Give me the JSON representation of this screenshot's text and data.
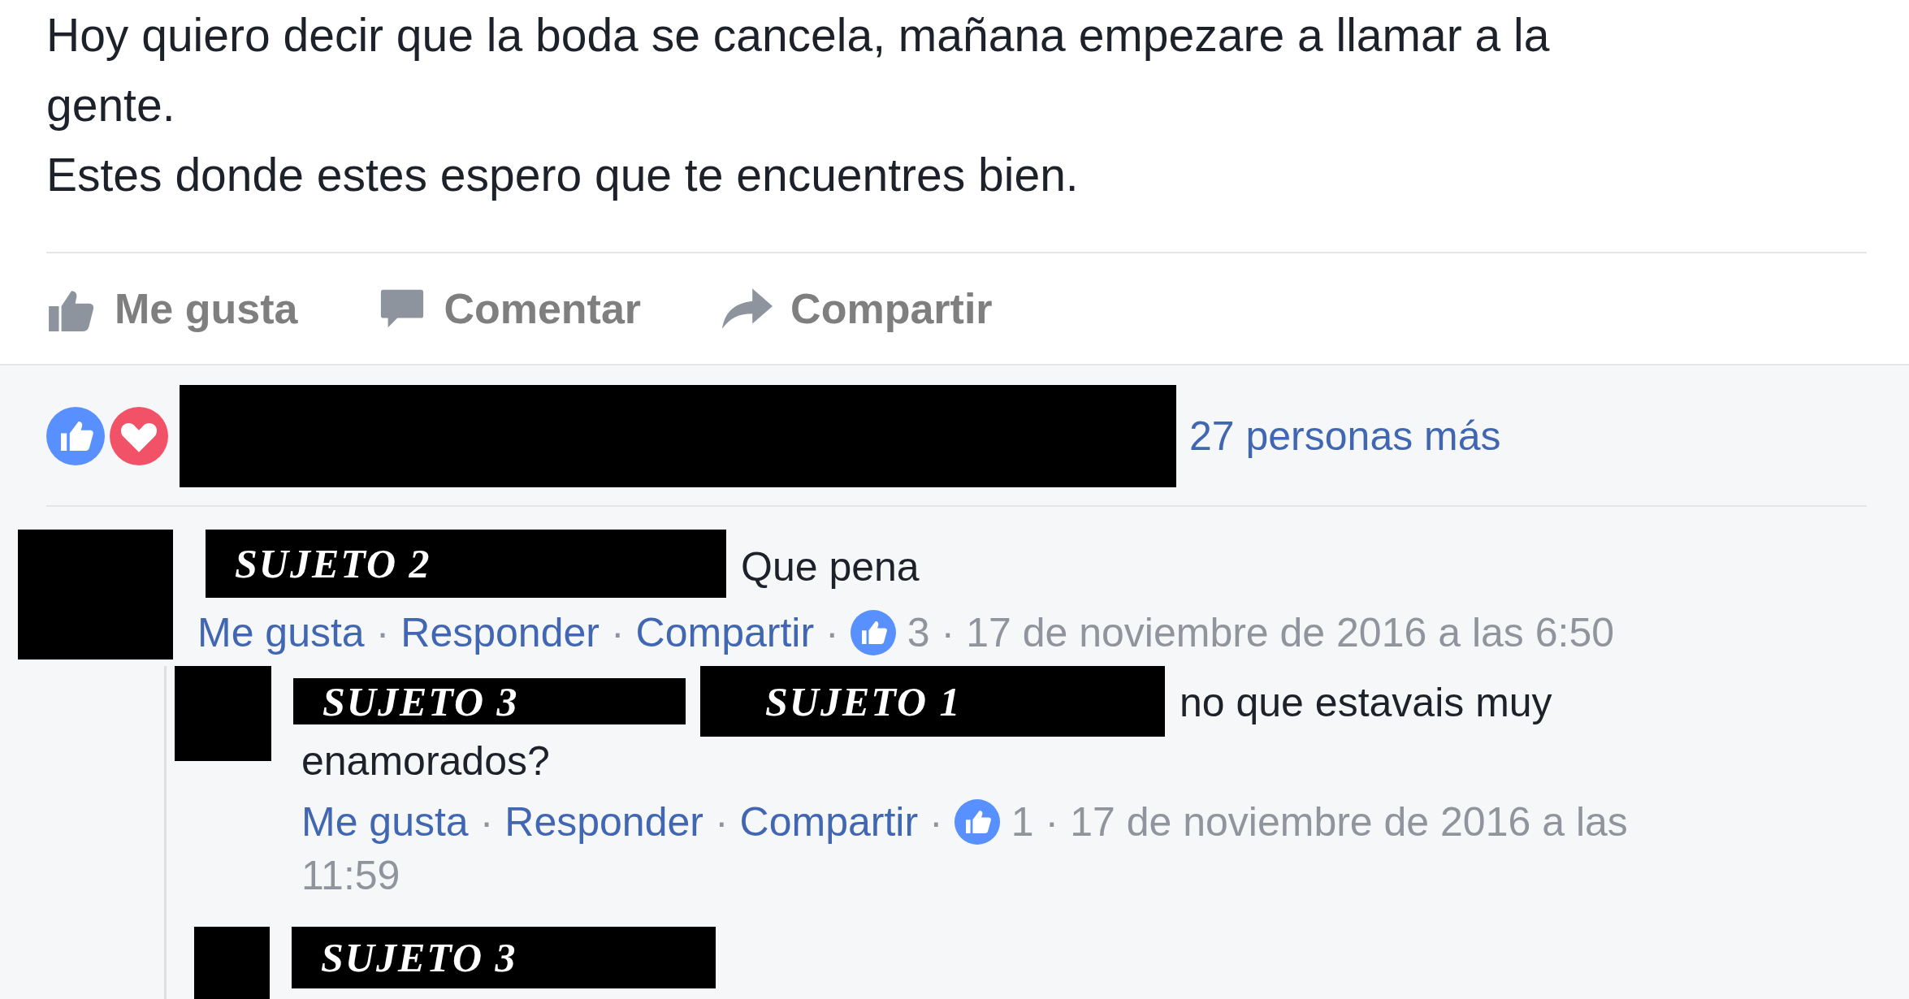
{
  "post": {
    "text_lines": [
      "Hoy quiero decir que la boda se cancela, mañana empezare a llamar a la",
      "gente.",
      "Estes donde estes espero que te encuentres bien."
    ],
    "actions": [
      {
        "kind": "like",
        "label": "Me gusta"
      },
      {
        "kind": "comment",
        "label": "Comentar"
      },
      {
        "kind": "share",
        "label": "Compartir"
      }
    ]
  },
  "reactions": {
    "icons": [
      {
        "kind": "like"
      },
      {
        "kind": "love"
      }
    ],
    "others": "27 personas más"
  },
  "separator": "·",
  "comments": [
    {
      "author_labels": [
        "SUJETO 2"
      ],
      "text_lines": [
        "Que pena"
      ],
      "actions": [
        "Me gusta",
        "Responder",
        "Compartir"
      ],
      "likes": "3",
      "time_lines": [
        "17 de noviembre de 2016 a las 6:50"
      ],
      "replies": [
        {
          "author_labels": [
            "SUJETO 3",
            "SUJETO 1"
          ],
          "text_lines": [
            "no que estavais muy",
            "enamorados?"
          ],
          "actions": [
            "Me gusta",
            "Responder",
            "Compartir"
          ],
          "likes": "1",
          "time_lines": [
            "17 de noviembre de 2016 a las",
            "11:59"
          ]
        },
        {
          "author_labels": [
            "SUJETO 3"
          ]
        }
      ]
    }
  ]
}
